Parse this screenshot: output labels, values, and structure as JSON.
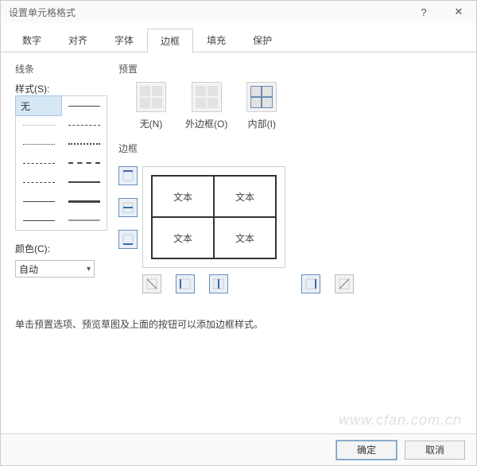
{
  "titlebar": {
    "title": "设置单元格格式"
  },
  "tabs": {
    "items": [
      {
        "label": "数字"
      },
      {
        "label": "对齐"
      },
      {
        "label": "字体"
      },
      {
        "label": "边框"
      },
      {
        "label": "填充"
      },
      {
        "label": "保护"
      }
    ]
  },
  "line": {
    "group_label": "线条",
    "style_label": "样式(S):",
    "none_label": "无"
  },
  "color": {
    "label": "颜色(C):",
    "value": "自动"
  },
  "preset": {
    "group_label": "预置",
    "none": "无(N)",
    "outer": "外边框(O)",
    "inner": "内部(I)"
  },
  "border": {
    "group_label": "边框",
    "sample_text": "文本"
  },
  "hint": "单击预置选项、预览草图及上面的按钮可以添加边框样式。",
  "footer": {
    "ok": "确定",
    "cancel": "取消"
  },
  "watermark": "www.cfan.com.cn"
}
